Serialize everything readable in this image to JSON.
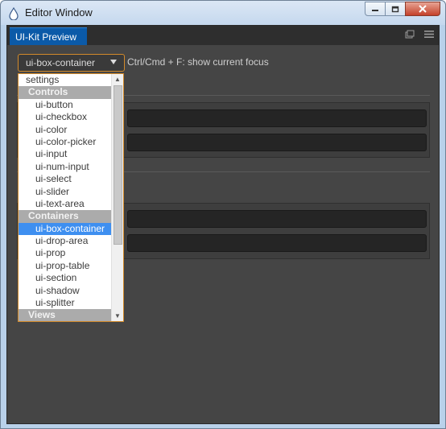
{
  "window": {
    "title": "Editor Window",
    "buttons": {
      "minimize": "minimize-icon",
      "restore": "restore-icon",
      "close": "close-icon"
    }
  },
  "panel": {
    "tab_label": "UI-Kit Preview",
    "tools": [
      "popout-icon",
      "menu-icon"
    ]
  },
  "selector": {
    "value": "ui-box-container",
    "hint": "Ctrl/Cmd + F: show current focus"
  },
  "dropdown": {
    "items": [
      {
        "label": "settings",
        "kind": "top"
      },
      {
        "label": "Controls",
        "kind": "group"
      },
      {
        "label": "ui-button",
        "kind": "item"
      },
      {
        "label": "ui-checkbox",
        "kind": "item"
      },
      {
        "label": "ui-color",
        "kind": "item"
      },
      {
        "label": "ui-color-picker",
        "kind": "item"
      },
      {
        "label": "ui-input",
        "kind": "item"
      },
      {
        "label": "ui-num-input",
        "kind": "item"
      },
      {
        "label": "ui-select",
        "kind": "item"
      },
      {
        "label": "ui-slider",
        "kind": "item"
      },
      {
        "label": "ui-text-area",
        "kind": "item"
      },
      {
        "label": "Containers",
        "kind": "group"
      },
      {
        "label": "ui-box-container",
        "kind": "selected"
      },
      {
        "label": "ui-drop-area",
        "kind": "item"
      },
      {
        "label": "ui-prop",
        "kind": "item"
      },
      {
        "label": "ui-prop-table",
        "kind": "item"
      },
      {
        "label": "ui-section",
        "kind": "item"
      },
      {
        "label": "ui-shadow",
        "kind": "item"
      },
      {
        "label": "ui-splitter",
        "kind": "item"
      },
      {
        "label": "Views",
        "kind": "group"
      }
    ]
  },
  "colors": {
    "accent": "#0b5aa8",
    "focus_border": "#d28a2a",
    "selection": "#3e8ff0",
    "panel_bg": "#454545"
  }
}
